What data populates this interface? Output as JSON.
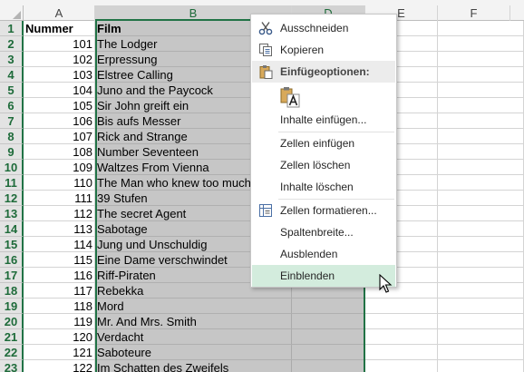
{
  "columns": [
    "A",
    "B",
    "D",
    "E",
    "F"
  ],
  "header_row": {
    "row": "1",
    "a": "Nummer",
    "b": "Film"
  },
  "rows": [
    {
      "row": "2",
      "num": "101",
      "film": "The Lodger"
    },
    {
      "row": "3",
      "num": "102",
      "film": "Erpressung"
    },
    {
      "row": "4",
      "num": "103",
      "film": "Elstree Calling"
    },
    {
      "row": "5",
      "num": "104",
      "film": "Juno and the Paycock"
    },
    {
      "row": "6",
      "num": "105",
      "film": "Sir John greift ein"
    },
    {
      "row": "7",
      "num": "106",
      "film": "Bis aufs Messer"
    },
    {
      "row": "8",
      "num": "107",
      "film": "Rick and Strange"
    },
    {
      "row": "9",
      "num": "108",
      "film": "Number Seventeen"
    },
    {
      "row": "10",
      "num": "109",
      "film": "Waltzes From Vienna"
    },
    {
      "row": "11",
      "num": "110",
      "film": "The Man who knew too much"
    },
    {
      "row": "12",
      "num": "111",
      "film": "39 Stufen"
    },
    {
      "row": "13",
      "num": "112",
      "film": "The secret Agent"
    },
    {
      "row": "14",
      "num": "113",
      "film": "Sabotage"
    },
    {
      "row": "15",
      "num": "114",
      "film": "Jung und Unschuldig"
    },
    {
      "row": "16",
      "num": "115",
      "film": "Eine Dame verschwindet"
    },
    {
      "row": "17",
      "num": "116",
      "film": "Riff-Piraten"
    },
    {
      "row": "18",
      "num": "117",
      "film": "Rebekka"
    },
    {
      "row": "19",
      "num": "118",
      "film": "Mord"
    },
    {
      "row": "20",
      "num": "119",
      "film": "Mr. And Mrs. Smith"
    },
    {
      "row": "21",
      "num": "120",
      "film": "Verdacht"
    },
    {
      "row": "22",
      "num": "121",
      "film": "Saboteure"
    },
    {
      "row": "23",
      "num": "122",
      "film": "Im Schatten des Zweifels"
    }
  ],
  "context_menu": {
    "cut": "Ausschneiden",
    "copy": "Kopieren",
    "paste_options": "Einfügeoptionen:",
    "paste_special": "Inhalte einfügen...",
    "insert_cells": "Zellen einfügen",
    "delete_cells": "Zellen löschen",
    "clear_contents": "Inhalte löschen",
    "format_cells": "Zellen formatieren...",
    "column_width": "Spaltenbreite...",
    "hide": "Ausblenden",
    "unhide": "Einblenden"
  },
  "icons": {
    "cut": "scissors-icon",
    "copy": "copy-icon",
    "paste_options": "clipboard-icon",
    "paste_value": "paste-text-icon",
    "format_cells": "format-cells-icon",
    "pointer": "mouse-pointer-icon"
  },
  "colors": {
    "accent": "#217346",
    "selection": "#c6c6c6",
    "menu_hover": "#d3ecdd"
  }
}
